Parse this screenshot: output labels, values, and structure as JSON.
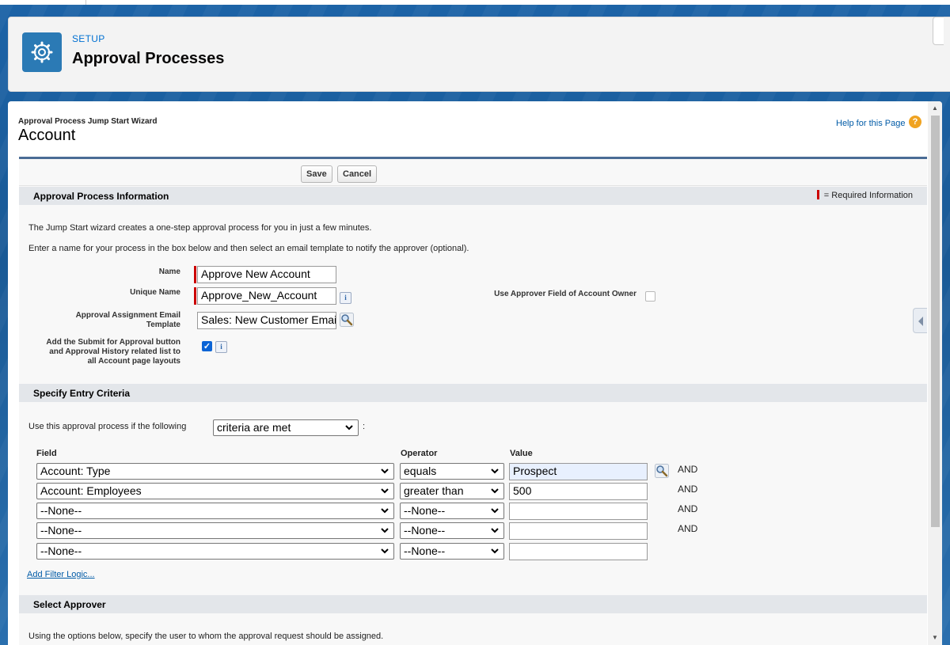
{
  "header": {
    "eyebrow": "SETUP",
    "title": "Approval Processes"
  },
  "page": {
    "wizard_label": "Approval Process Jump Start Wizard",
    "record_title": "Account",
    "help_link": "Help for this Page",
    "help_icon": "?"
  },
  "buttons": {
    "save": "Save",
    "cancel": "Cancel"
  },
  "sections": {
    "info": "Approval Process Information",
    "required_legend": "= Required Information",
    "entry": "Specify Entry Criteria",
    "approver": "Select Approver"
  },
  "text": {
    "intro1": "The Jump Start wizard creates a one-step approval process for you in just a few minutes.",
    "intro2": "Enter a name for your process in the box below and then select an email template to notify the approver (optional).",
    "criteria_prefix": "Use this approval process if the following",
    "criteria_suffix": ":",
    "approver_text": "Using the options below, specify the user to whom the approval request should be assigned."
  },
  "fields": {
    "name_label": "Name",
    "name_value": "Approve New Account",
    "unique_label": "Unique Name",
    "unique_value": "Approve_New_Account",
    "info_icon": "i",
    "template_label": "Approval Assignment Email Template",
    "template_value": "Sales: New Customer Email",
    "submit_label": "Add the Submit for Approval button and Approval History related list to all Account page layouts",
    "submit_check": "✓",
    "approver_field_label": "Use Approver Field of Account Owner"
  },
  "criteria": {
    "selected": "criteria are met",
    "headers": {
      "field": "Field",
      "operator": "Operator",
      "value": "Value"
    },
    "rows": [
      {
        "field": "Account: Type",
        "operator": "equals",
        "value": "Prospect",
        "and": "AND"
      },
      {
        "field": "Account: Employees",
        "operator": "greater than",
        "value": "500",
        "and": "AND"
      },
      {
        "field": "--None--",
        "operator": "--None--",
        "value": "",
        "and": "AND"
      },
      {
        "field": "--None--",
        "operator": "--None--",
        "value": "",
        "and": "AND"
      },
      {
        "field": "--None--",
        "operator": "--None--",
        "value": "",
        "and": ""
      }
    ],
    "filter_logic_link": "Add Filter Logic..."
  },
  "colors": {
    "accent": "#0070d2",
    "header_icon_bg": "#2b7ab5",
    "required": "#cc0000",
    "section_bg": "#e3e6ea"
  }
}
